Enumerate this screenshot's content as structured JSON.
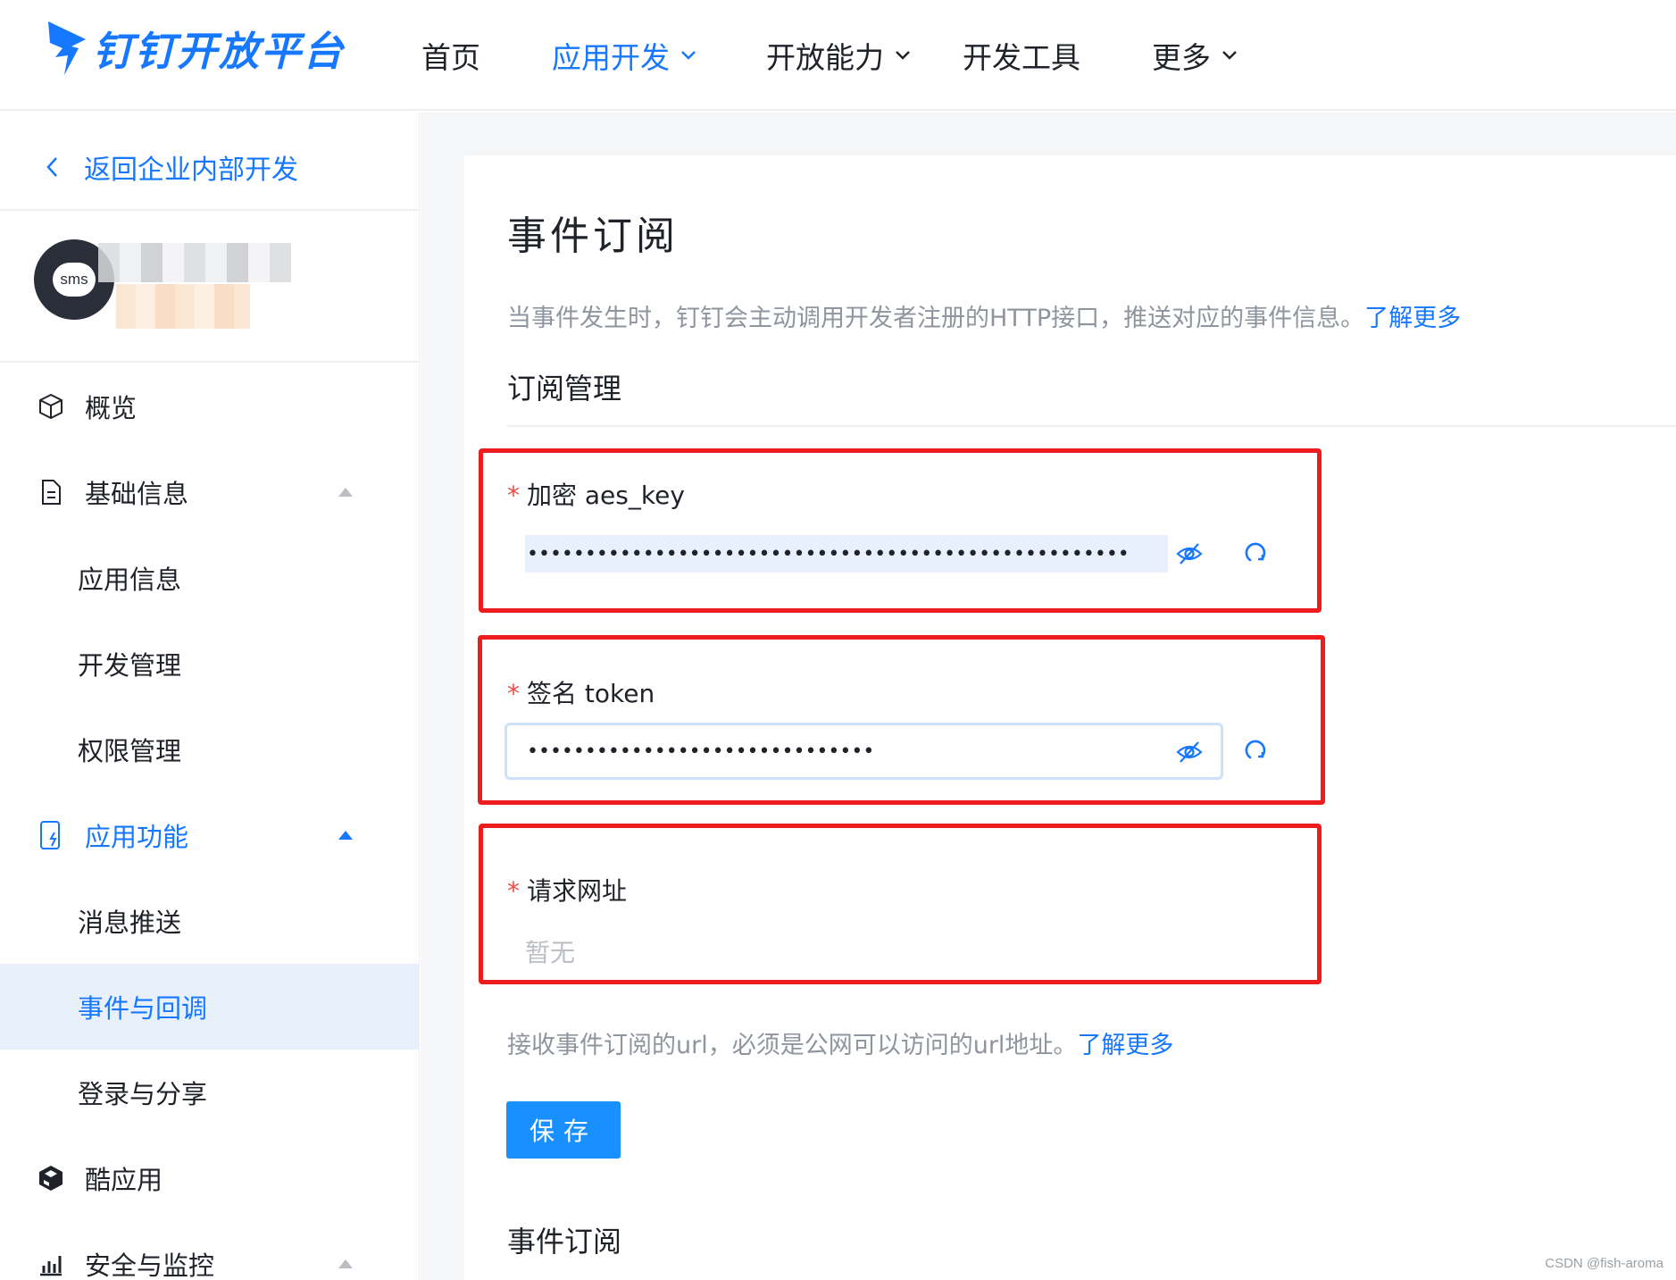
{
  "brand": {
    "name": "钉钉开放平台",
    "accent": "#1677ff"
  },
  "nav": {
    "items": [
      {
        "label": "首页",
        "active": false,
        "dropdown": false
      },
      {
        "label": "应用开发",
        "active": true,
        "dropdown": true
      },
      {
        "label": "开放能力",
        "active": false,
        "dropdown": true
      },
      {
        "label": "开发工具",
        "active": false,
        "dropdown": false
      },
      {
        "label": "更多",
        "active": false,
        "dropdown": true
      }
    ]
  },
  "sidebar": {
    "back_label": "返回企业内部开发",
    "app_icon_text": "sms",
    "items": [
      {
        "label": "概览",
        "icon": "cube-icon"
      },
      {
        "label": "基础信息",
        "icon": "document-icon",
        "expanded": true
      },
      {
        "label": "应用信息"
      },
      {
        "label": "开发管理"
      },
      {
        "label": "权限管理"
      },
      {
        "label": "应用功能",
        "icon": "phone-function-icon",
        "expanded": true
      },
      {
        "label": "消息推送"
      },
      {
        "label": "事件与回调",
        "selected": true
      },
      {
        "label": "登录与分享"
      },
      {
        "label": "酷应用",
        "icon": "cool-app-icon"
      },
      {
        "label": "安全与监控",
        "icon": "bar-chart-icon",
        "expanded": true
      }
    ]
  },
  "main": {
    "title": "事件订阅",
    "description": "当事件发生时，钉钉会主动调用开发者注册的HTTP接口，推送对应的事件信息。",
    "learn_more": "了解更多",
    "subscription_section": "订阅管理",
    "fields": {
      "aes_key": {
        "required_mark": "*",
        "label": "加密 aes_key",
        "masked_value": "••••••••••••••••••••••••••••••••••••••••••••••••••••"
      },
      "token": {
        "required_mark": "*",
        "label": "签名 token",
        "masked_value": "••••••••••••••••••••••••••••••"
      },
      "url": {
        "required_mark": "*",
        "label": "请求网址",
        "value": "暂无"
      }
    },
    "url_hint": "接收事件订阅的url，必须是公网可以访问的url地址。",
    "url_hint_link": "了解更多",
    "save_button": "保存",
    "event_section": "事件订阅"
  },
  "watermark": "CSDN @fish-aroma",
  "colors": {
    "highlight_box": "#ee1c1c",
    "primary_button": "#1890ff",
    "required": "#f54a45"
  }
}
